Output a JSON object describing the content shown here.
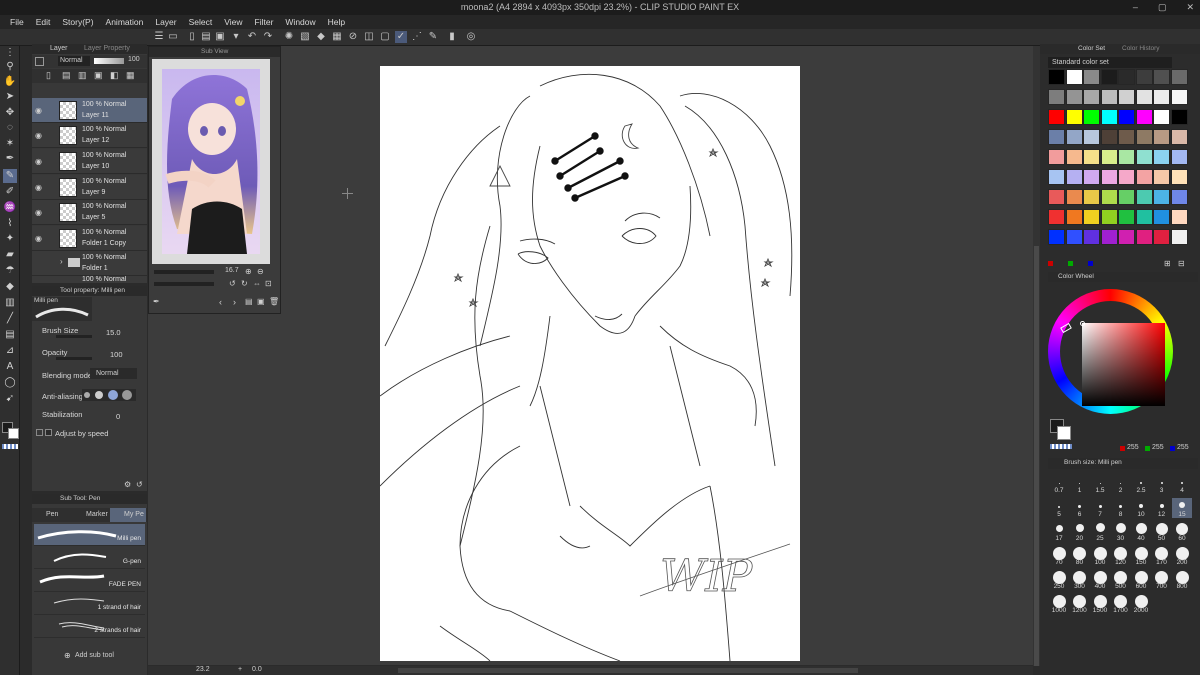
{
  "window": {
    "title": "moona2 (A4 2894 x 4093px 350dpi 23.2%) - CLIP STUDIO PAINT EX"
  },
  "menu": [
    "File",
    "Edit",
    "Story(P)",
    "Animation",
    "Layer",
    "Select",
    "View",
    "Filter",
    "Window",
    "Help"
  ],
  "layer_panel": {
    "tabs": [
      "Layer",
      "Layer Property"
    ],
    "blend_mode": "Normal",
    "opacity": "100",
    "layers": [
      {
        "line1": "100 % Normal",
        "line2": "Layer 11",
        "selected": true
      },
      {
        "line1": "100 % Normal",
        "line2": "Layer 12",
        "selected": false
      },
      {
        "line1": "100 % Normal",
        "line2": "Layer 10",
        "selected": false
      },
      {
        "line1": "100 % Normal",
        "line2": "Layer 9",
        "selected": false
      },
      {
        "line1": "100 % Normal",
        "line2": "Layer 5",
        "selected": false
      },
      {
        "line1": "100 % Normal",
        "line2": "Folder 1 Copy",
        "selected": false
      },
      {
        "line1": "100 % Normal",
        "line2": "Folder 1",
        "selected": false
      },
      {
        "line1": "100 % Normal",
        "line2": "",
        "selected": false
      }
    ]
  },
  "canvas_tab": "moona2",
  "sub_view": {
    "title": "Sub View",
    "zoom": "16.7"
  },
  "tool_property": {
    "title": "Tool property: Milli pen",
    "tool_name": "Milli pen",
    "brush_size_label": "Brush Size",
    "brush_size": "15.0",
    "opacity_label": "Opacity",
    "opacity": "100",
    "blending_label": "Blending mode",
    "blending_value": "Normal",
    "antialias_label": "Anti-aliasing",
    "stabilization_label": "Stabilization",
    "stabilization": "0",
    "adjust_label": "Adjust by speed"
  },
  "sub_tool": {
    "title": "Sub Tool: Pen",
    "tabs": [
      "Pen",
      "Marker",
      "My Pe"
    ],
    "brushes": [
      "Milli pen",
      "G-pen",
      "FADE PEN",
      "1 strand of hair",
      "2 strands of hair"
    ],
    "add_label": "Add sub tool"
  },
  "status": {
    "zoom": "23.2",
    "angle": "0.0"
  },
  "color_set": {
    "tabs": [
      "Color Set",
      "Color History"
    ],
    "set_name": "Standard color set",
    "swatches": [
      [
        "#000000",
        "#ffffff",
        "#8a8a8a",
        "#1c1c1c",
        "#2a2a2a",
        "#3d3d3d",
        "#505050",
        "#6a6a6a"
      ],
      [
        "#7d7d7d",
        "#949494",
        "#a8a8a8",
        "#bdbdbd",
        "#d0d0d0",
        "#e2e2e2",
        "#ececec",
        "#f6f6f6"
      ],
      [
        "#ff0000",
        "#ffff00",
        "#00ff00",
        "#00ffff",
        "#0000ff",
        "#ff00ff",
        "#ffffff",
        "#000000"
      ],
      [
        "#6b7fa8",
        "#93a6c7",
        "#b7c7dd",
        "#4e4037",
        "#6e5b4b",
        "#8e7a64",
        "#b89a84",
        "#d9b8a8"
      ],
      [
        "#f29c9c",
        "#f6b98e",
        "#f5e08a",
        "#d8ee8c",
        "#a9e7a3",
        "#8fe0d0",
        "#8bd2f0",
        "#a3b8f2"
      ],
      [
        "#a7c4f2",
        "#b5b0f2",
        "#d0a9f0",
        "#eca8e3",
        "#f5a8c9",
        "#f3a3a3",
        "#f6c8a8",
        "#ffe2b8"
      ],
      [
        "#e85a5a",
        "#ea8a4e",
        "#e8c848",
        "#aedb4c",
        "#66cf66",
        "#4ccab0",
        "#4cb3e6",
        "#6f87e8"
      ],
      [
        "#f03030",
        "#f07820",
        "#f0d020",
        "#90d020",
        "#20c040",
        "#20c0a0",
        "#2090e0",
        "#ffd8c0"
      ],
      [
        "#0030ff",
        "#3050ff",
        "#6030e0",
        "#a020d0",
        "#d020b0",
        "#e02080",
        "#e02040",
        "#f0f0f0"
      ]
    ]
  },
  "color_wheel": {
    "tab": "Color Wheel",
    "r": "255",
    "g": "255",
    "b": "255"
  },
  "brush_size_panel": {
    "title": "Brush size: Milli pen",
    "sizes": [
      {
        "label": "0.7",
        "d": 1
      },
      {
        "label": "1",
        "d": 1
      },
      {
        "label": "1.5",
        "d": 1
      },
      {
        "label": "2",
        "d": 1
      },
      {
        "label": "2.5",
        "d": 2
      },
      {
        "label": "3",
        "d": 2
      },
      {
        "label": "4",
        "d": 2
      },
      {
        "label": "5",
        "d": 2
      },
      {
        "label": "6",
        "d": 3
      },
      {
        "label": "7",
        "d": 3
      },
      {
        "label": "8",
        "d": 3
      },
      {
        "label": "10",
        "d": 4
      },
      {
        "label": "12",
        "d": 4
      },
      {
        "label": "15",
        "d": 6
      },
      {
        "label": "17",
        "d": 7
      },
      {
        "label": "20",
        "d": 8
      },
      {
        "label": "25",
        "d": 9
      },
      {
        "label": "30",
        "d": 10
      },
      {
        "label": "40",
        "d": 11
      },
      {
        "label": "50",
        "d": 12
      },
      {
        "label": "60",
        "d": 12
      },
      {
        "label": "70",
        "d": 13
      },
      {
        "label": "80",
        "d": 13
      },
      {
        "label": "100",
        "d": 13
      },
      {
        "label": "120",
        "d": 13
      },
      {
        "label": "150",
        "d": 13
      },
      {
        "label": "170",
        "d": 13
      },
      {
        "label": "200",
        "d": 13
      },
      {
        "label": "250",
        "d": 13
      },
      {
        "label": "300",
        "d": 13
      },
      {
        "label": "400",
        "d": 13
      },
      {
        "label": "500",
        "d": 13
      },
      {
        "label": "600",
        "d": 13
      },
      {
        "label": "700",
        "d": 13
      },
      {
        "label": "800",
        "d": 13
      },
      {
        "label": "1000",
        "d": 13
      },
      {
        "label": "1200",
        "d": 13
      },
      {
        "label": "1500",
        "d": 13
      },
      {
        "label": "1700",
        "d": 13
      },
      {
        "label": "2000",
        "d": 13
      }
    ],
    "selected": "15"
  },
  "canvas_text": "WIP"
}
